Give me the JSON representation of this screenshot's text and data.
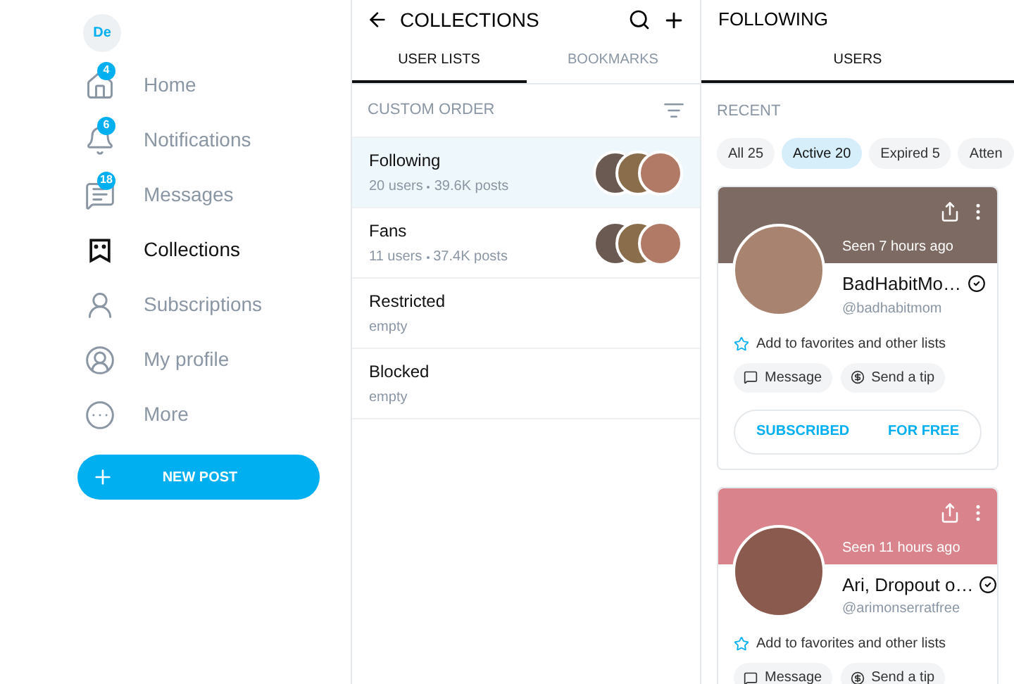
{
  "sidebar": {
    "avatar": "De",
    "items": [
      {
        "kind": "home",
        "label": "Home",
        "badge": "4",
        "selected": false
      },
      {
        "kind": "bell",
        "label": "Notifications",
        "badge": "6",
        "selected": false
      },
      {
        "kind": "messages",
        "label": "Messages",
        "badge": "18",
        "selected": false
      },
      {
        "kind": "collections",
        "label": "Collections",
        "selected": true
      },
      {
        "kind": "subscriptions",
        "label": "Subscriptions",
        "selected": false
      },
      {
        "kind": "profile",
        "label": "My profile",
        "selected": false
      },
      {
        "kind": "more",
        "label": "More",
        "selected": false
      }
    ],
    "new_post": "NEW POST"
  },
  "collections": {
    "title": "COLLECTIONS",
    "tabs": [
      {
        "label": "USER LISTS",
        "selected": true
      },
      {
        "label": "BOOKMARKS",
        "selected": false
      }
    ],
    "sort_label": "CUSTOM ORDER",
    "lists": [
      {
        "name": "Following",
        "users": "20 users",
        "posts": "39.6K posts",
        "has_avatars": true,
        "selected": true
      },
      {
        "name": "Fans",
        "users": "11 users",
        "posts": "37.4K posts",
        "has_avatars": true,
        "selected": false
      },
      {
        "name": "Restricted",
        "summary": "empty",
        "has_avatars": false,
        "selected": false
      },
      {
        "name": "Blocked",
        "summary": "empty",
        "has_avatars": false,
        "selected": false
      }
    ]
  },
  "following": {
    "title": "FOLLOWING",
    "tabs": [
      {
        "label": "USERS",
        "selected": true
      }
    ],
    "section": "RECENT",
    "filters": [
      {
        "label": "All 25",
        "selected": false
      },
      {
        "label": "Active 20",
        "selected": true
      },
      {
        "label": "Expired 5",
        "selected": false
      },
      {
        "label": "Atten",
        "selected": false
      }
    ],
    "cards": [
      {
        "seen": "Seen 7 hours ago",
        "name": "BadHabitMo…",
        "handle": "@badhabitmom",
        "verified": true,
        "favorites": "Add to favorites and other lists",
        "message": "Message",
        "tip": "Send a tip",
        "subscription": {
          "status": "SUBSCRIBED",
          "price": "FOR FREE"
        }
      },
      {
        "seen": "Seen 11 hours ago",
        "name": "Ari, Dropout o…",
        "handle": "@arimonserratfree",
        "verified": true,
        "favorites": "Add to favorites and other lists",
        "message": "Message",
        "tip": "Send a tip"
      }
    ]
  }
}
